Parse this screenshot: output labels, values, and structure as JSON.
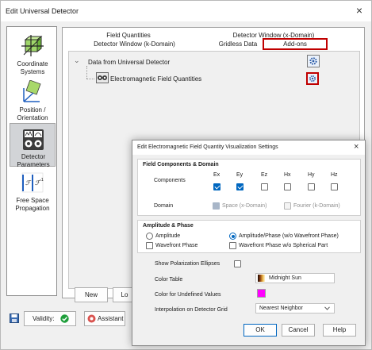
{
  "main_dialog": {
    "title": "Edit Universal Detector",
    "close_glyph": "×"
  },
  "left_nav": {
    "items": [
      {
        "label": "Coordinate Systems",
        "icon": "coordinate-axes-icon",
        "selected": false
      },
      {
        "label": "Position / Orientation",
        "icon": "position-orientation-icon",
        "selected": false
      },
      {
        "label": "Detector Parameters",
        "icon": "detector-parameters-icon",
        "selected": true
      },
      {
        "label": "Free Space Propagation",
        "icon": "free-space-propagation-icon",
        "selected": false
      }
    ]
  },
  "tabs": {
    "row1": [
      "Field Quantities",
      "Detector Window (x-Domain)"
    ],
    "row2": [
      "Detector Window (k-Domain)",
      "Gridless Data",
      "Add-ons"
    ],
    "active": "Add-ons"
  },
  "tree": {
    "root_label": "Data from Universal Detector",
    "child_label": "Electromagnetic Field Quantities",
    "expand_glyph": "⌄"
  },
  "main_buttons": {
    "new_label": "New",
    "load_label": "Lo",
    "validity_label": "Validity:",
    "assistant_label": "Assistant"
  },
  "sub_dialog": {
    "title": "Edit Electromagnetic Field Quantity Visualization Settings",
    "close_glyph": "×",
    "field_components": {
      "title": "Field Components & Domain",
      "components_label": "Components",
      "columns": [
        {
          "name": "Ex",
          "checked": true
        },
        {
          "name": "Ey",
          "checked": true
        },
        {
          "name": "Ez",
          "checked": false
        },
        {
          "name": "Hx",
          "checked": false
        },
        {
          "name": "Hy",
          "checked": false
        },
        {
          "name": "Hz",
          "checked": false
        }
      ],
      "domain_label": "Domain",
      "domain_space": "Space (x-Domain)",
      "domain_fourier": "Fourier (k-Domain)"
    },
    "amplitude_phase": {
      "title": "Amplitude & Phase",
      "amplitude": "Amplitude",
      "amplitude_phase": "Amplitude/Phase (w/o Wavefront Phase)",
      "wavefront_phase": "Wavefront Phase",
      "wavefront_phase_wo": "Wavefront Phase w/o Spherical Part",
      "selected": "Amplitude/Phase (w/o Wavefront Phase)"
    },
    "settings": {
      "polarization_label": "Show Polarization Ellipses",
      "color_table_label": "Color Table",
      "color_table_value": "Midnight Sun",
      "undefined_color_label": "Color for Undefined Values",
      "undefined_color": "#ff00ff",
      "interpolation_label": "Interpolation on Detector Grid",
      "interpolation_value": "Nearest Neighbor"
    },
    "buttons": {
      "ok": "OK",
      "cancel": "Cancel",
      "help": "Help"
    }
  },
  "colors": {
    "highlight_red": "#c00000",
    "accent_blue": "#0067c0",
    "validity_green": "#1e9e3a"
  }
}
